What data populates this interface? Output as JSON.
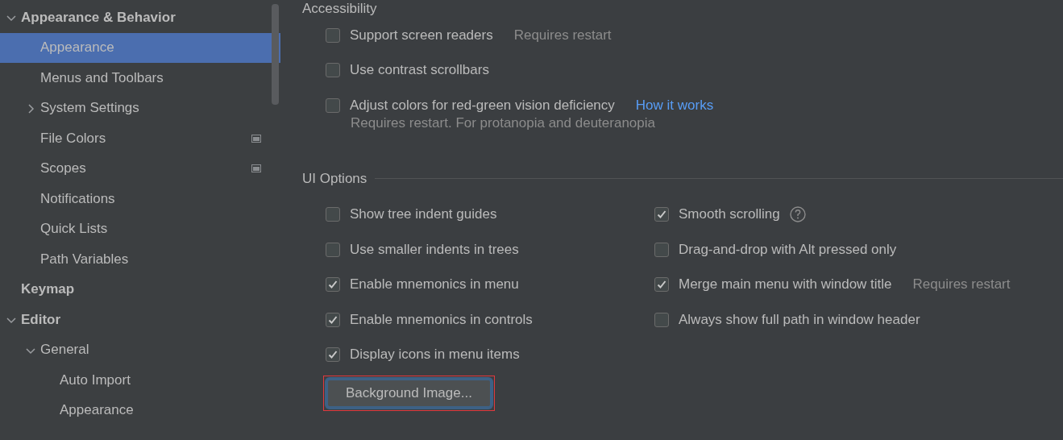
{
  "sidebar": {
    "items": [
      {
        "label": "Appearance & Behavior",
        "bold": true,
        "selected": false,
        "expanded": true,
        "badge": false,
        "children": [
          {
            "label": "Appearance",
            "bold": false,
            "selected": true,
            "badge": false
          },
          {
            "label": "Menus and Toolbars",
            "bold": false,
            "selected": false,
            "badge": false
          },
          {
            "label": "System Settings",
            "bold": false,
            "selected": false,
            "expanded": false,
            "badge": false
          },
          {
            "label": "File Colors",
            "bold": false,
            "selected": false,
            "badge": true
          },
          {
            "label": "Scopes",
            "bold": false,
            "selected": false,
            "badge": true
          },
          {
            "label": "Notifications",
            "bold": false,
            "selected": false,
            "badge": false
          },
          {
            "label": "Quick Lists",
            "bold": false,
            "selected": false,
            "badge": false
          },
          {
            "label": "Path Variables",
            "bold": false,
            "selected": false,
            "badge": false
          }
        ]
      },
      {
        "label": "Keymap",
        "bold": true,
        "selected": false,
        "badge": false
      },
      {
        "label": "Editor",
        "bold": true,
        "selected": false,
        "expanded": true,
        "badge": false,
        "children": [
          {
            "label": "General",
            "bold": false,
            "selected": false,
            "expanded": true,
            "badge": false,
            "children": [
              {
                "label": "Auto Import",
                "bold": false,
                "selected": false,
                "badge": false
              },
              {
                "label": "Appearance",
                "bold": false,
                "selected": false,
                "badge": false
              }
            ]
          }
        ]
      }
    ]
  },
  "accessibility": {
    "title": "Accessibility",
    "options": [
      {
        "label": "Support screen readers",
        "checked": false,
        "note": "Requires restart"
      },
      {
        "label": "Use contrast scrollbars",
        "checked": false
      },
      {
        "label": "Adjust colors for red-green vision deficiency",
        "checked": false,
        "link": "How it works",
        "subnote": "Requires restart. For protanopia and deuteranopia"
      }
    ]
  },
  "ui_options": {
    "title": "UI Options",
    "left": [
      {
        "label": "Show tree indent guides",
        "checked": false
      },
      {
        "label": "Use smaller indents in trees",
        "checked": false
      },
      {
        "label": "Enable mnemonics in menu",
        "checked": true
      },
      {
        "label": "Enable mnemonics in controls",
        "checked": true
      },
      {
        "label": "Display icons in menu items",
        "checked": true
      }
    ],
    "right": [
      {
        "label": "Smooth scrolling",
        "checked": true,
        "help": true
      },
      {
        "label": "Drag-and-drop with Alt pressed only",
        "checked": false
      },
      {
        "label": "Merge main menu with window title",
        "checked": true,
        "note": "Requires restart"
      },
      {
        "label": "Always show full path in window header",
        "checked": false
      }
    ],
    "button": {
      "label": "Background Image...",
      "focused": true,
      "highlighted": true
    }
  }
}
